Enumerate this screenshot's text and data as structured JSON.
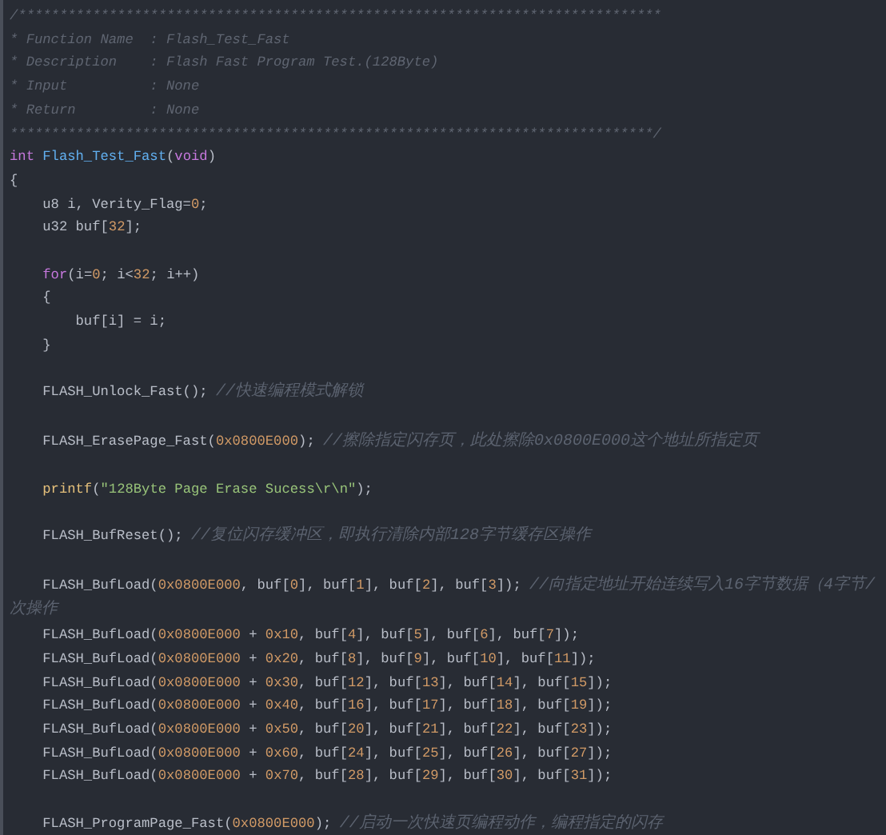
{
  "editor": {
    "lines": [
      {
        "kind": "code",
        "tokens": [
          {
            "kind": "doc",
            "text": "/******************************************************************************"
          }
        ]
      },
      {
        "kind": "code",
        "tokens": [
          {
            "kind": "doc",
            "text": "* Function Name  : Flash_Test_Fast"
          }
        ]
      },
      {
        "kind": "code",
        "tokens": [
          {
            "kind": "doc",
            "text": "* Description    : Flash Fast Program Test.(128Byte)"
          }
        ]
      },
      {
        "kind": "code",
        "tokens": [
          {
            "kind": "doc",
            "text": "* Input          : None"
          }
        ]
      },
      {
        "kind": "code",
        "tokens": [
          {
            "kind": "doc",
            "text": "* Return         : None"
          }
        ]
      },
      {
        "kind": "code",
        "tokens": [
          {
            "kind": "doc",
            "text": "******************************************************************************/"
          }
        ]
      },
      {
        "kind": "code",
        "tokens": [
          {
            "kind": "keyword",
            "text": "int"
          },
          {
            "kind": "function",
            "text": " Flash_Test_Fast"
          },
          {
            "kind": "plain",
            "text": "("
          },
          {
            "kind": "keyword",
            "text": "void"
          },
          {
            "kind": "plain",
            "text": ")"
          }
        ]
      },
      {
        "kind": "code",
        "tokens": [
          {
            "kind": "plain",
            "text": "{"
          }
        ]
      },
      {
        "kind": "code",
        "tokens": [
          {
            "kind": "plain",
            "text": "    u8 i, Verity_Flag="
          },
          {
            "kind": "number",
            "text": "0"
          },
          {
            "kind": "plain",
            "text": ";"
          }
        ]
      },
      {
        "kind": "code",
        "tokens": [
          {
            "kind": "plain",
            "text": "    u32 buf["
          },
          {
            "kind": "number",
            "text": "32"
          },
          {
            "kind": "plain",
            "text": "];"
          }
        ]
      },
      {
        "kind": "blank"
      },
      {
        "kind": "code",
        "tokens": [
          {
            "kind": "keyword",
            "text": "    for"
          },
          {
            "kind": "plain",
            "text": "(i="
          },
          {
            "kind": "number",
            "text": "0"
          },
          {
            "kind": "plain",
            "text": "; i<"
          },
          {
            "kind": "number",
            "text": "32"
          },
          {
            "kind": "plain",
            "text": "; i++)"
          }
        ]
      },
      {
        "kind": "code",
        "tokens": [
          {
            "kind": "plain",
            "text": "    {"
          }
        ]
      },
      {
        "kind": "code",
        "tokens": [
          {
            "kind": "plain",
            "text": "        buf[i] = i;"
          }
        ]
      },
      {
        "kind": "code",
        "tokens": [
          {
            "kind": "plain",
            "text": "    }"
          }
        ]
      },
      {
        "kind": "blank"
      },
      {
        "kind": "code",
        "tokens": [
          {
            "kind": "plain",
            "text": "    FLASH_Unlock_Fast(); "
          },
          {
            "kind": "comment",
            "text": "//快速编程模式解锁"
          }
        ]
      },
      {
        "kind": "blank"
      },
      {
        "kind": "code",
        "tokens": [
          {
            "kind": "plain",
            "text": "    FLASH_ErasePage_Fast("
          },
          {
            "kind": "number",
            "text": "0x0800E000"
          },
          {
            "kind": "plain",
            "text": "); "
          },
          {
            "kind": "comment",
            "text": "//擦除指定闪存页，此处擦除0x0800E000这个地址所指定页"
          }
        ]
      },
      {
        "kind": "blank"
      },
      {
        "kind": "code",
        "tokens": [
          {
            "kind": "builtin",
            "text": "    printf"
          },
          {
            "kind": "plain",
            "text": "("
          },
          {
            "kind": "string",
            "text": "\"128Byte Page Erase Sucess\\r\\n\""
          },
          {
            "kind": "plain",
            "text": ");"
          }
        ]
      },
      {
        "kind": "blank"
      },
      {
        "kind": "code",
        "tokens": [
          {
            "kind": "plain",
            "text": "    FLASH_BufReset(); "
          },
          {
            "kind": "comment",
            "text": "//复位闪存缓冲区，即执行清除内部128字节缓存区操作"
          }
        ]
      },
      {
        "kind": "blank"
      },
      {
        "kind": "code",
        "tokens": [
          {
            "kind": "plain",
            "text": "    FLASH_BufLoad("
          },
          {
            "kind": "number",
            "text": "0x0800E000"
          },
          {
            "kind": "plain",
            "text": ", buf["
          },
          {
            "kind": "number",
            "text": "0"
          },
          {
            "kind": "plain",
            "text": "], buf["
          },
          {
            "kind": "number",
            "text": "1"
          },
          {
            "kind": "plain",
            "text": "], buf["
          },
          {
            "kind": "number",
            "text": "2"
          },
          {
            "kind": "plain",
            "text": "], buf["
          },
          {
            "kind": "number",
            "text": "3"
          },
          {
            "kind": "plain",
            "text": "]); "
          },
          {
            "kind": "comment",
            "text": "//向指定地址开始连续写入16字节数据（4字节/次操作"
          }
        ]
      },
      {
        "kind": "code",
        "tokens": [
          {
            "kind": "plain",
            "text": "    FLASH_BufLoad("
          },
          {
            "kind": "number",
            "text": "0x0800E000"
          },
          {
            "kind": "plain",
            "text": " + "
          },
          {
            "kind": "number",
            "text": "0x10"
          },
          {
            "kind": "plain",
            "text": ", buf["
          },
          {
            "kind": "number",
            "text": "4"
          },
          {
            "kind": "plain",
            "text": "], buf["
          },
          {
            "kind": "number",
            "text": "5"
          },
          {
            "kind": "plain",
            "text": "], buf["
          },
          {
            "kind": "number",
            "text": "6"
          },
          {
            "kind": "plain",
            "text": "], buf["
          },
          {
            "kind": "number",
            "text": "7"
          },
          {
            "kind": "plain",
            "text": "]);"
          }
        ]
      },
      {
        "kind": "code",
        "tokens": [
          {
            "kind": "plain",
            "text": "    FLASH_BufLoad("
          },
          {
            "kind": "number",
            "text": "0x0800E000"
          },
          {
            "kind": "plain",
            "text": " + "
          },
          {
            "kind": "number",
            "text": "0x20"
          },
          {
            "kind": "plain",
            "text": ", buf["
          },
          {
            "kind": "number",
            "text": "8"
          },
          {
            "kind": "plain",
            "text": "], buf["
          },
          {
            "kind": "number",
            "text": "9"
          },
          {
            "kind": "plain",
            "text": "], buf["
          },
          {
            "kind": "number",
            "text": "10"
          },
          {
            "kind": "plain",
            "text": "], buf["
          },
          {
            "kind": "number",
            "text": "11"
          },
          {
            "kind": "plain",
            "text": "]);"
          }
        ]
      },
      {
        "kind": "code",
        "tokens": [
          {
            "kind": "plain",
            "text": "    FLASH_BufLoad("
          },
          {
            "kind": "number",
            "text": "0x0800E000"
          },
          {
            "kind": "plain",
            "text": " + "
          },
          {
            "kind": "number",
            "text": "0x30"
          },
          {
            "kind": "plain",
            "text": ", buf["
          },
          {
            "kind": "number",
            "text": "12"
          },
          {
            "kind": "plain",
            "text": "], buf["
          },
          {
            "kind": "number",
            "text": "13"
          },
          {
            "kind": "plain",
            "text": "], buf["
          },
          {
            "kind": "number",
            "text": "14"
          },
          {
            "kind": "plain",
            "text": "], buf["
          },
          {
            "kind": "number",
            "text": "15"
          },
          {
            "kind": "plain",
            "text": "]);"
          }
        ]
      },
      {
        "kind": "code",
        "tokens": [
          {
            "kind": "plain",
            "text": "    FLASH_BufLoad("
          },
          {
            "kind": "number",
            "text": "0x0800E000"
          },
          {
            "kind": "plain",
            "text": " + "
          },
          {
            "kind": "number",
            "text": "0x40"
          },
          {
            "kind": "plain",
            "text": ", buf["
          },
          {
            "kind": "number",
            "text": "16"
          },
          {
            "kind": "plain",
            "text": "], buf["
          },
          {
            "kind": "number",
            "text": "17"
          },
          {
            "kind": "plain",
            "text": "], buf["
          },
          {
            "kind": "number",
            "text": "18"
          },
          {
            "kind": "plain",
            "text": "], buf["
          },
          {
            "kind": "number",
            "text": "19"
          },
          {
            "kind": "plain",
            "text": "]);"
          }
        ]
      },
      {
        "kind": "code",
        "tokens": [
          {
            "kind": "plain",
            "text": "    FLASH_BufLoad("
          },
          {
            "kind": "number",
            "text": "0x0800E000"
          },
          {
            "kind": "plain",
            "text": " + "
          },
          {
            "kind": "number",
            "text": "0x50"
          },
          {
            "kind": "plain",
            "text": ", buf["
          },
          {
            "kind": "number",
            "text": "20"
          },
          {
            "kind": "plain",
            "text": "], buf["
          },
          {
            "kind": "number",
            "text": "21"
          },
          {
            "kind": "plain",
            "text": "], buf["
          },
          {
            "kind": "number",
            "text": "22"
          },
          {
            "kind": "plain",
            "text": "], buf["
          },
          {
            "kind": "number",
            "text": "23"
          },
          {
            "kind": "plain",
            "text": "]);"
          }
        ]
      },
      {
        "kind": "code",
        "tokens": [
          {
            "kind": "plain",
            "text": "    FLASH_BufLoad("
          },
          {
            "kind": "number",
            "text": "0x0800E000"
          },
          {
            "kind": "plain",
            "text": " + "
          },
          {
            "kind": "number",
            "text": "0x60"
          },
          {
            "kind": "plain",
            "text": ", buf["
          },
          {
            "kind": "number",
            "text": "24"
          },
          {
            "kind": "plain",
            "text": "], buf["
          },
          {
            "kind": "number",
            "text": "25"
          },
          {
            "kind": "plain",
            "text": "], buf["
          },
          {
            "kind": "number",
            "text": "26"
          },
          {
            "kind": "plain",
            "text": "], buf["
          },
          {
            "kind": "number",
            "text": "27"
          },
          {
            "kind": "plain",
            "text": "]);"
          }
        ]
      },
      {
        "kind": "code",
        "tokens": [
          {
            "kind": "plain",
            "text": "    FLASH_BufLoad("
          },
          {
            "kind": "number",
            "text": "0x0800E000"
          },
          {
            "kind": "plain",
            "text": " + "
          },
          {
            "kind": "number",
            "text": "0x70"
          },
          {
            "kind": "plain",
            "text": ", buf["
          },
          {
            "kind": "number",
            "text": "28"
          },
          {
            "kind": "plain",
            "text": "], buf["
          },
          {
            "kind": "number",
            "text": "29"
          },
          {
            "kind": "plain",
            "text": "], buf["
          },
          {
            "kind": "number",
            "text": "30"
          },
          {
            "kind": "plain",
            "text": "], buf["
          },
          {
            "kind": "number",
            "text": "31"
          },
          {
            "kind": "plain",
            "text": "]);"
          }
        ]
      },
      {
        "kind": "blank"
      },
      {
        "kind": "code",
        "tokens": [
          {
            "kind": "plain",
            "text": "    FLASH_ProgramPage_Fast("
          },
          {
            "kind": "number",
            "text": "0x0800E000"
          },
          {
            "kind": "plain",
            "text": "); "
          },
          {
            "kind": "comment",
            "text": "//启动一次快速页编程动作，编程指定的闪存"
          }
        ]
      }
    ]
  }
}
